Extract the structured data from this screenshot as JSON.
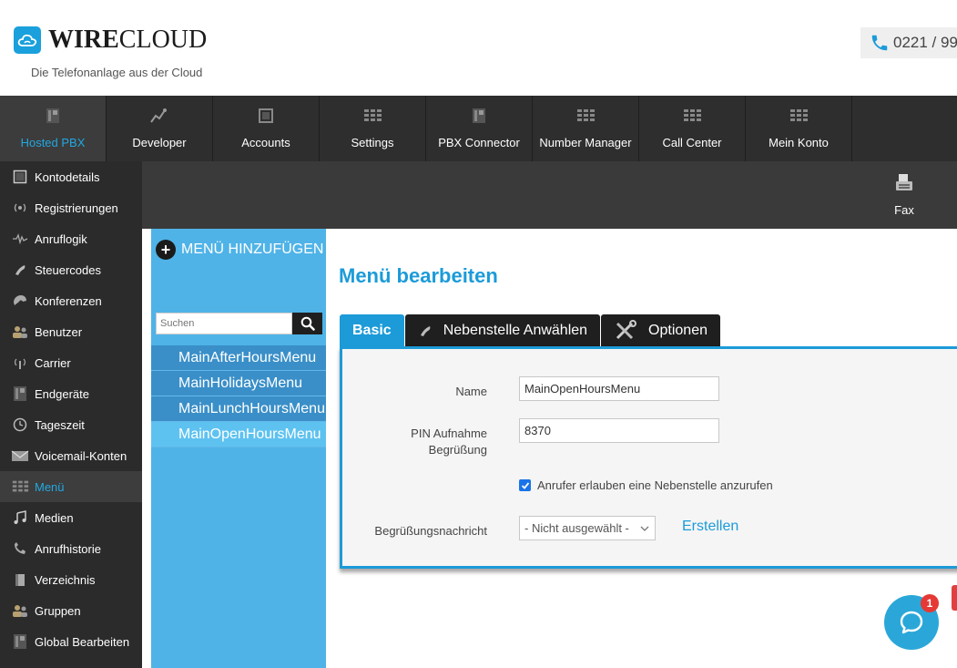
{
  "header": {
    "logo_bold": "WIRE",
    "logo_light": "CLOUD",
    "tagline": "Die Telefonanlage aus der Cloud",
    "phone": "0221 / 99"
  },
  "topnav": {
    "items": [
      {
        "label": "Hosted PBX",
        "icon": "device-icon"
      },
      {
        "label": "Developer",
        "icon": "graph-icon"
      },
      {
        "label": "Accounts",
        "icon": "box-icon"
      },
      {
        "label": "Settings",
        "icon": "grid-icon"
      },
      {
        "label": "PBX Connector",
        "icon": "device-icon"
      },
      {
        "label": "Number Manager",
        "icon": "grid-icon"
      },
      {
        "label": "Call Center",
        "icon": "grid-icon"
      },
      {
        "label": "Mein Konto",
        "icon": "grid-icon"
      }
    ],
    "active": "Hosted PBX"
  },
  "subbar": {
    "fax_label": "Fax"
  },
  "sidebar": {
    "items": [
      {
        "label": "Kontodetails",
        "icon": "window-icon"
      },
      {
        "label": "Registrierungen",
        "icon": "signal-icon"
      },
      {
        "label": "Anruflogik",
        "icon": "flow-icon"
      },
      {
        "label": "Steuercodes",
        "icon": "phone-handset-icon"
      },
      {
        "label": "Konferenzen",
        "icon": "conference-icon"
      },
      {
        "label": "Benutzer",
        "icon": "users-icon"
      },
      {
        "label": "Carrier",
        "icon": "antenna-icon"
      },
      {
        "label": "Endgeräte",
        "icon": "device-icon"
      },
      {
        "label": "Tageszeit",
        "icon": "clock-icon"
      },
      {
        "label": "Voicemail-Konten",
        "icon": "mail-icon"
      },
      {
        "label": "Menü",
        "icon": "grid-icon"
      },
      {
        "label": "Medien",
        "icon": "music-icon"
      },
      {
        "label": "Anrufhistorie",
        "icon": "phone-history-icon"
      },
      {
        "label": "Verzeichnis",
        "icon": "book-icon"
      },
      {
        "label": "Gruppen",
        "icon": "users-icon"
      },
      {
        "label": "Global Bearbeiten",
        "icon": "device-icon"
      }
    ],
    "active": "Menü"
  },
  "menu_panel": {
    "add_label": "MENÜ HINZUFÜGEN",
    "search_placeholder": "Suchen",
    "items": [
      "MainAfterHoursMenu",
      "MainHolidaysMenu",
      "MainLunchHoursMenu",
      "MainOpenHoursMenu"
    ],
    "active": "MainOpenHoursMenu"
  },
  "content": {
    "title": "Menü bearbeiten",
    "tabs": [
      {
        "label": "Basic",
        "icon": ""
      },
      {
        "label": "Nebenstelle Anwählen",
        "icon": "phone-handset-icon"
      },
      {
        "label": "Optionen",
        "icon": "tools-icon"
      }
    ],
    "active_tab": "Basic",
    "form": {
      "name_label": "Name",
      "name_value": "MainOpenHoursMenu",
      "pin_label_line1": "PIN Aufnahme",
      "pin_label_line2": "Begrüßung",
      "pin_value": "8370",
      "checkbox_label": "Anrufer erlauben eine Nebenstelle anzurufen",
      "checkbox_checked": true,
      "greeting_label": "Begrüßungsnachricht",
      "greeting_select": "- Nicht ausgewählt -",
      "create_label": "Erstellen"
    }
  },
  "chat": {
    "badge": "1"
  },
  "colors": {
    "accent": "#1c9bd8",
    "nav_bg": "#2e2e2e",
    "menu_bg": "#4fb3e7",
    "badge": "#e53935"
  }
}
